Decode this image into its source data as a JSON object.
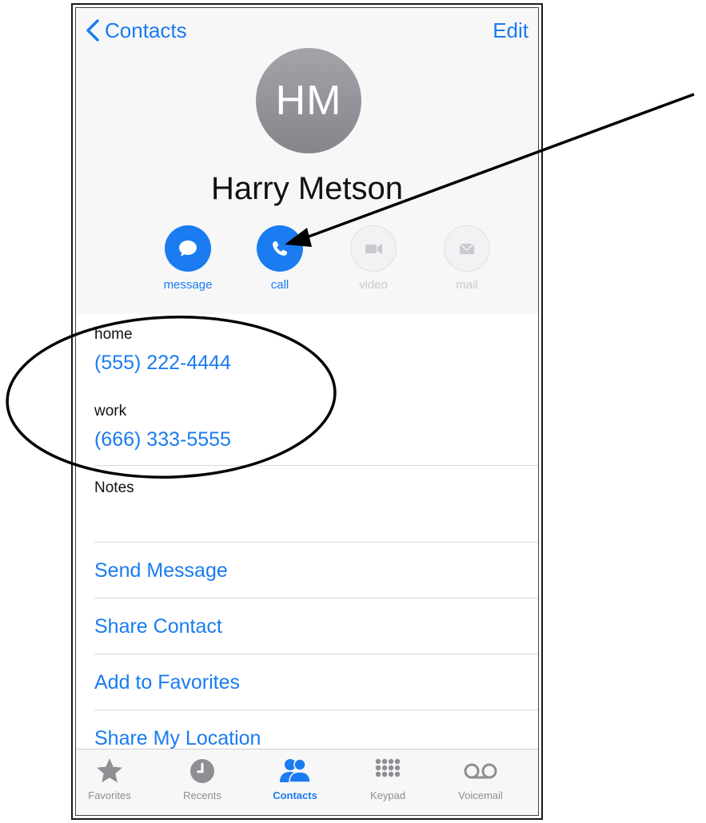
{
  "nav": {
    "back_label": "Contacts",
    "edit_label": "Edit"
  },
  "contact": {
    "initials": "HM",
    "name": "Harry Metson"
  },
  "actions": [
    {
      "label": "message",
      "enabled": true
    },
    {
      "label": "call",
      "enabled": true
    },
    {
      "label": "video",
      "enabled": false
    },
    {
      "label": "mail",
      "enabled": false
    }
  ],
  "phones": [
    {
      "label": "home",
      "number": "(555) 222-4444"
    },
    {
      "label": "work",
      "number": "(666) 333-5555"
    }
  ],
  "notes_label": "Notes",
  "links": [
    {
      "label": "Send Message"
    },
    {
      "label": "Share Contact"
    },
    {
      "label": "Add to Favorites"
    },
    {
      "label": "Share My Location"
    }
  ],
  "tabs": [
    {
      "label": "Favorites",
      "icon": "star-icon",
      "active": false
    },
    {
      "label": "Recents",
      "icon": "clock-icon",
      "active": false
    },
    {
      "label": "Contacts",
      "icon": "contacts-icon",
      "active": true
    },
    {
      "label": "Keypad",
      "icon": "keypad-icon",
      "active": false
    },
    {
      "label": "Voicemail",
      "icon": "voicemail-icon",
      "active": false
    }
  ],
  "colors": {
    "accent": "#1a7cf0",
    "avatar": "#9a9ba0",
    "disabled": "#c9c9cf",
    "inactive_tab": "#8e8e93"
  }
}
